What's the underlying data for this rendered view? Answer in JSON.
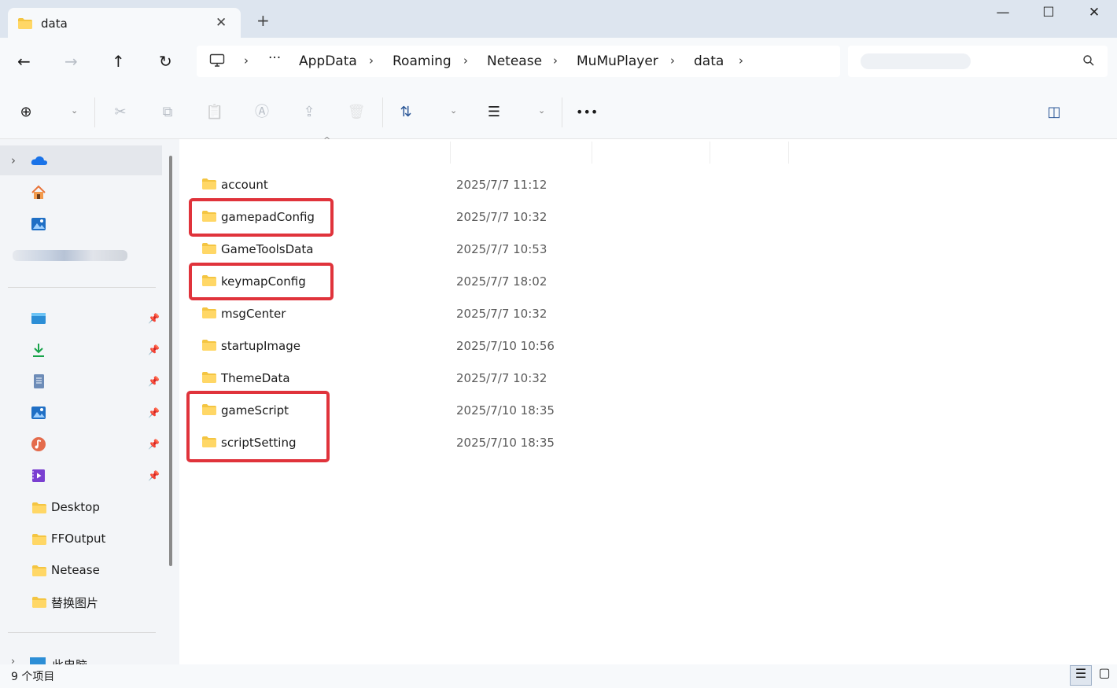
{
  "window": {
    "tab_title": "data",
    "tab_close_glyph": "✕",
    "new_tab_glyph": "+",
    "minimize_glyph": "—",
    "maximize_glyph": "☐",
    "close_glyph": "✕"
  },
  "nav": {
    "back_glyph": "←",
    "forward_glyph": "→",
    "up_glyph": "↑",
    "refresh_glyph": "↻",
    "more_glyph": "···",
    "breadcrumbs": [
      "AppData",
      "Roaming",
      "Netease",
      "MuMuPlayer",
      "data"
    ],
    "separator_glyph": "›",
    "search_icon_glyph": "⌕"
  },
  "toolbar": {
    "icons": [
      "new-icon",
      "cut-icon",
      "copy-icon",
      "paste-icon",
      "rename-icon",
      "share-icon",
      "delete-icon",
      "sort-icon",
      "view-icon",
      "more-icon",
      "details-pane-icon"
    ],
    "new_glyph": "⊕",
    "cut_glyph": "✂",
    "copy_glyph": "⧉",
    "paste_glyph": "📋",
    "rename_glyph": "Ⓐ",
    "share_glyph": "⇪",
    "delete_glyph": "🗑",
    "sort_glyph": "⇅",
    "view_glyph": "☰",
    "more_glyph": "•••",
    "caret_glyph": "⌄",
    "details_glyph": "◫"
  },
  "sidebar": {
    "sort_caret": "^",
    "expand_glyph": "›",
    "quick_items": [
      "onedrive-icon",
      "home-icon",
      "gallery-icon"
    ],
    "pinned": [
      "desktop-icon",
      "downloads-icon",
      "documents-icon",
      "pictures-icon",
      "music-icon",
      "videos-icon"
    ],
    "pin_glyph": "📌",
    "folders": [
      "Desktop",
      "FFOutput",
      "Netease",
      "替换图片"
    ],
    "this_pc_partial": "此电脑"
  },
  "files": [
    {
      "name": "account",
      "date": "2025/7/7 11:12"
    },
    {
      "name": "gamepadConfig",
      "date": "2025/7/7 10:32"
    },
    {
      "name": "GameToolsData",
      "date": "2025/7/7 10:53"
    },
    {
      "name": "keymapConfig",
      "date": "2025/7/7 18:02"
    },
    {
      "name": "msgCenter",
      "date": "2025/7/7 10:32"
    },
    {
      "name": "startupImage",
      "date": "2025/7/10 10:56"
    },
    {
      "name": "ThemeData",
      "date": "2025/7/7 10:32"
    },
    {
      "name": "gameScript",
      "date": "2025/7/10 18:35"
    },
    {
      "name": "scriptSetting",
      "date": "2025/7/10 18:35"
    }
  ],
  "highlight_color": "#e0333b",
  "status": {
    "item_count": "9 个项目",
    "details_view_glyph": "☰",
    "tiles_view_glyph": "▢"
  }
}
